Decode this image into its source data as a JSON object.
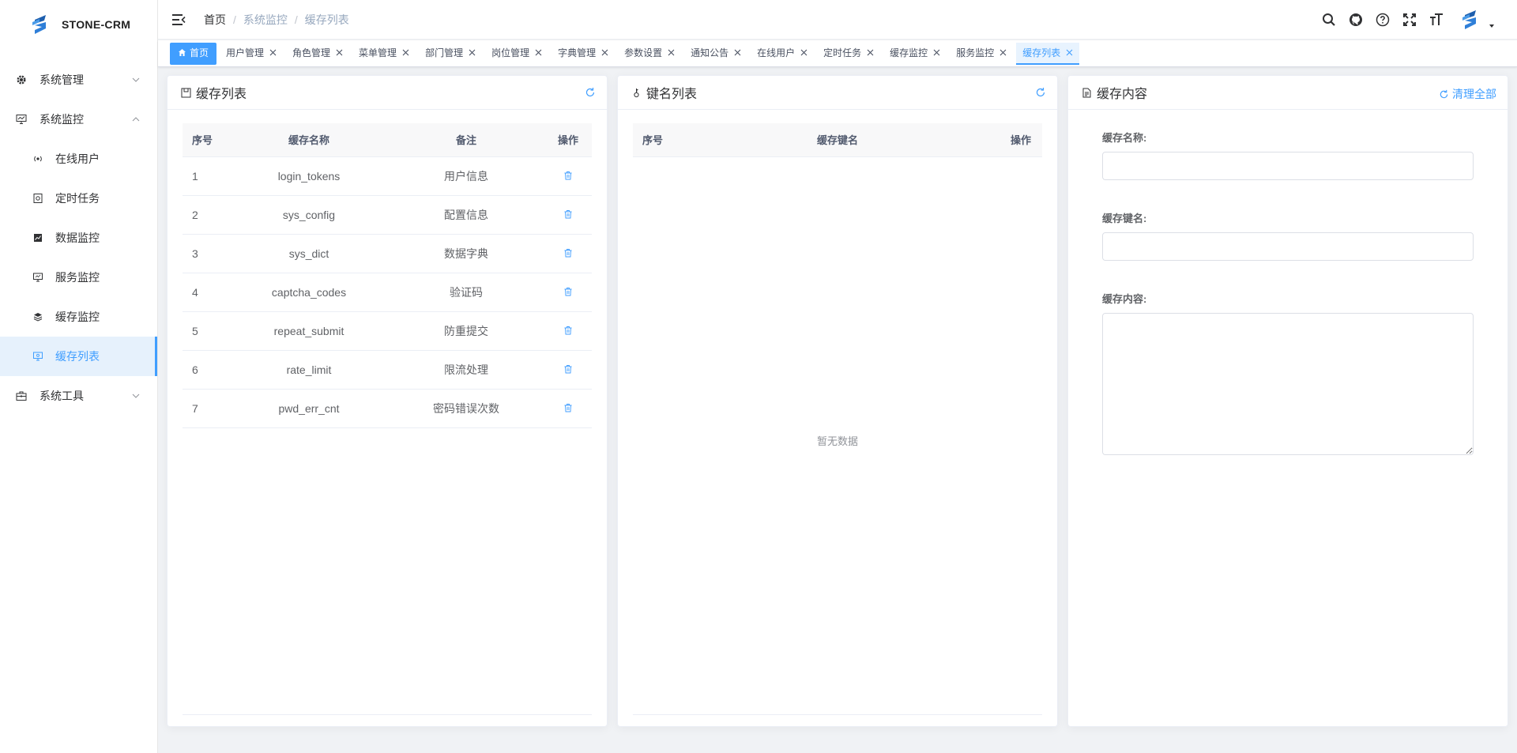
{
  "app": {
    "name": "STONE-CRM"
  },
  "sidebar": {
    "menus": [
      {
        "label": "系统管理",
        "icon": "gear-icon"
      },
      {
        "label": "系统监控",
        "icon": "monitor-icon"
      },
      {
        "label": "系统工具",
        "icon": "toolbox-icon"
      }
    ],
    "submenus": [
      {
        "label": "在线用户",
        "icon": "online-icon"
      },
      {
        "label": "定时任务",
        "icon": "job-icon"
      },
      {
        "label": "数据监控",
        "icon": "data-chart-icon"
      },
      {
        "label": "服务监控",
        "icon": "server-icon"
      },
      {
        "label": "缓存监控",
        "icon": "stack-icon"
      },
      {
        "label": "缓存列表",
        "icon": "cache-list-icon"
      }
    ]
  },
  "header": {
    "breadcrumb": [
      "首页",
      "系统监控",
      "缓存列表"
    ]
  },
  "tags": [
    "首页",
    "用户管理",
    "角色管理",
    "菜单管理",
    "部门管理",
    "岗位管理",
    "字典管理",
    "参数设置",
    "通知公告",
    "在线用户",
    "定时任务",
    "缓存监控",
    "服务监控",
    "缓存列表"
  ],
  "cache_card": {
    "title": "缓存列表",
    "columns": [
      "序号",
      "缓存名称",
      "备注",
      "操作"
    ],
    "rows": [
      {
        "index": "1",
        "name": "login_tokens",
        "remark": "用户信息"
      },
      {
        "index": "2",
        "name": "sys_config",
        "remark": "配置信息"
      },
      {
        "index": "3",
        "name": "sys_dict",
        "remark": "数据字典"
      },
      {
        "index": "4",
        "name": "captcha_codes",
        "remark": "验证码"
      },
      {
        "index": "5",
        "name": "repeat_submit",
        "remark": "防重提交"
      },
      {
        "index": "6",
        "name": "rate_limit",
        "remark": "限流处理"
      },
      {
        "index": "7",
        "name": "pwd_err_cnt",
        "remark": "密码错误次数"
      }
    ]
  },
  "keys_card": {
    "title": "键名列表",
    "columns": [
      "序号",
      "缓存键名",
      "操作"
    ],
    "empty_text": "暂无数据"
  },
  "content_card": {
    "title": "缓存内容",
    "clear_label": "清理全部",
    "fields": {
      "name_label": "缓存名称:",
      "key_label": "缓存键名:",
      "content_label": "缓存内容:"
    }
  },
  "colors": {
    "primary": "#409eff",
    "active_bg": "#e6f1fc"
  }
}
